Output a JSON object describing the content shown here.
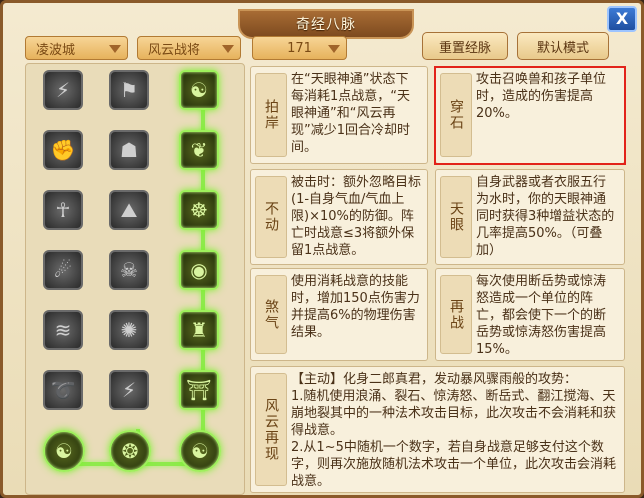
{
  "window": {
    "title": "奇经八脉",
    "close_label": "X"
  },
  "toolbar": {
    "region_dropdown": "凌波城",
    "school_dropdown": "风云战将",
    "level_value": "171",
    "reset_button": "重置经脉",
    "default_button": "默认模式"
  },
  "tree": {
    "nodes": [
      {
        "icon": "roaring-beast-icon",
        "glyph": "⚡",
        "active": false
      },
      {
        "icon": "banner-icon",
        "glyph": "⚑",
        "active": false
      },
      {
        "icon": "swirl-cloud-icon",
        "glyph": "☯",
        "active": true
      },
      {
        "icon": "fist-icon",
        "glyph": "✊",
        "active": false
      },
      {
        "icon": "silhouette-icon",
        "glyph": "☗",
        "active": false
      },
      {
        "icon": "wind-leaf-icon",
        "glyph": "❦",
        "active": true
      },
      {
        "icon": "warrior-icon",
        "glyph": "☥",
        "active": false
      },
      {
        "icon": "mountain-icon",
        "glyph": "⛰",
        "active": false
      },
      {
        "icon": "meditating-figure-icon",
        "glyph": "☸",
        "active": true
      },
      {
        "icon": "crumbling-rock-icon",
        "glyph": "☄",
        "active": false
      },
      {
        "icon": "skull-icon",
        "glyph": "☠",
        "active": false
      },
      {
        "icon": "eye-icon",
        "glyph": "◉",
        "active": true
      },
      {
        "icon": "waves-icon",
        "glyph": "≋",
        "active": false
      },
      {
        "icon": "shatter-icon",
        "glyph": "✺",
        "active": false
      },
      {
        "icon": "robed-figure-icon",
        "glyph": "♜",
        "active": true
      },
      {
        "icon": "tornado-icon",
        "glyph": "➰",
        "active": false
      },
      {
        "icon": "lightning-circle-icon",
        "glyph": "⚡",
        "active": false
      },
      {
        "icon": "gate-icon",
        "glyph": "⛩",
        "active": true
      },
      {
        "icon": "dragon-swirl-icon",
        "glyph": "☯",
        "active": true
      },
      {
        "icon": "dragon-head-icon",
        "glyph": "❂",
        "active": true
      },
      {
        "icon": "spiral-orb-icon",
        "glyph": "☯",
        "active": true
      }
    ]
  },
  "cards": [
    {
      "title": "拍岸",
      "text": "在“天眼神通”状态下每消耗1点战意，“天眼神通”和“风云再现”减少1回合冷却时间。"
    },
    {
      "title": "穿石",
      "text": "攻击召唤兽和孩子单位时，造成的伤害提高20%。"
    },
    {
      "title": "不动",
      "text": "被击时：额外忽略目标(1-自身气血/气血上限)×10%的防御。阵亡时战意≤3将额外保留1点战意。"
    },
    {
      "title": "天眼",
      "text": "自身武器或者衣服五行为水时，你的天眼神通同时获得3种增益状态的几率提高50%。（可叠加）"
    },
    {
      "title": "煞气",
      "text": "使用消耗战意的技能时，增加150点伤害力并提高6%的物理伤害结果。"
    },
    {
      "title": "再战",
      "text": "每次使用断岳势或惊涛怒造成一个单位的阵亡，都会使下一个的断岳势或惊涛怒伤害提高15%。"
    },
    {
      "title": "风云再现",
      "text": "【主动】化身二郎真君，发动暴风骤雨般的攻势：\n1.随机使用浪涌、裂石、惊涛怒、断岳式、翻江搅海、天崩地裂其中的一种法术攻击目标，此次攻击不会消耗和获得战意。\n2.从1~5中随机一个数字，若自身战意足够支付这个数字，则再次施放随机法术攻击一个单位，此次攻击会消耗战意。"
    }
  ]
}
